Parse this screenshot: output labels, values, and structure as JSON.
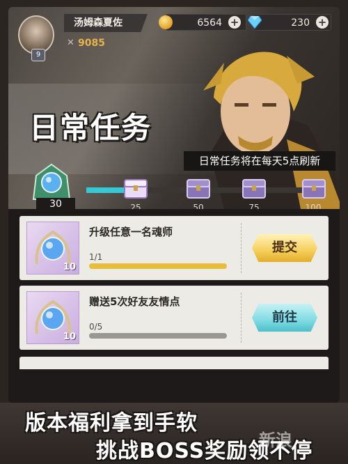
{
  "player": {
    "name": "汤姆森夏佐",
    "level": "9",
    "power": "9085"
  },
  "resources": {
    "gold": "6564",
    "diamonds": "230"
  },
  "page": {
    "title": "日常任务",
    "refresh_notice": "日常任务将在每天5点刷新"
  },
  "activity": {
    "current": "30",
    "progress_fraction": 0.18,
    "milestones": [
      "25",
      "50",
      "75",
      "100"
    ]
  },
  "tasks": [
    {
      "title": "升级任意一名魂师",
      "progress": "1/1",
      "fill": 1.0,
      "reward_count": "10",
      "button": "提交"
    },
    {
      "title": "赠送5次好友友情点",
      "progress": "0/5",
      "fill": 0.0,
      "reward_count": "10",
      "button": "前往"
    }
  ],
  "promo": {
    "line1": "版本福利拿到手软",
    "line2": "挑战BOSS奖励领不停",
    "watermark": "新浪"
  },
  "colors": {
    "accent_gold": "#e8b34a",
    "progress_cyan": "#35c9d8",
    "button_yellow": "#f5cf5b",
    "button_cyan": "#7fdbe3"
  }
}
